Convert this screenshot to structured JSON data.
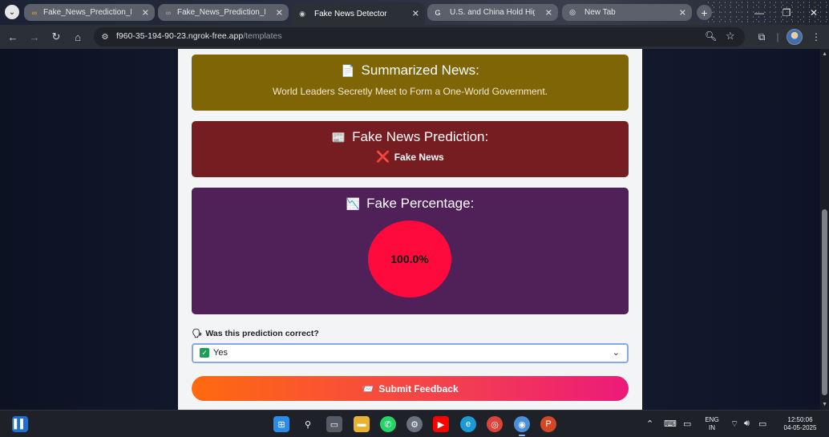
{
  "browser": {
    "tabs": [
      {
        "title": "Fake_News_Prediction_Bot",
        "icon": "colab-icon",
        "active": false
      },
      {
        "title": "Fake_News_Prediction_New",
        "icon": "colab-icon",
        "active": false
      },
      {
        "title": "Fake News Detector",
        "icon": "globe-icon",
        "active": true
      },
      {
        "title": "U.S. and China Hold High-L",
        "icon": "google-icon",
        "active": false
      },
      {
        "title": "New Tab",
        "icon": "chrome-icon",
        "active": false
      }
    ],
    "url_host": "f960-35-194-90-23.ngrok-free.app",
    "url_path": "/templates"
  },
  "page": {
    "summary": {
      "icon": "📄",
      "title": "Summarized News:",
      "text": "World Leaders Secretly Meet to Form a One-World Government."
    },
    "prediction": {
      "icon": "📰",
      "title": "Fake News Prediction:",
      "result_icon": "❌",
      "result": "Fake News"
    },
    "fake_percentage": {
      "icon": "📉",
      "title": "Fake Percentage:",
      "label": "100.0%",
      "value": 100.0,
      "color": "#ff0a3c"
    },
    "feedback": {
      "question_icon": "🗣",
      "question": "Was this prediction correct?",
      "selected_icon": "✅",
      "selected": "Yes",
      "submit_icon": "📨",
      "submit_label": "Submit Feedback"
    }
  },
  "chart_data": {
    "type": "pie",
    "categories": [
      "Fake"
    ],
    "values": [
      100.0
    ],
    "title": "Fake Percentage:"
  },
  "taskbar": {
    "language": "ENG",
    "region": "IN",
    "time": "12:50:06",
    "date": "04-05-2025"
  }
}
